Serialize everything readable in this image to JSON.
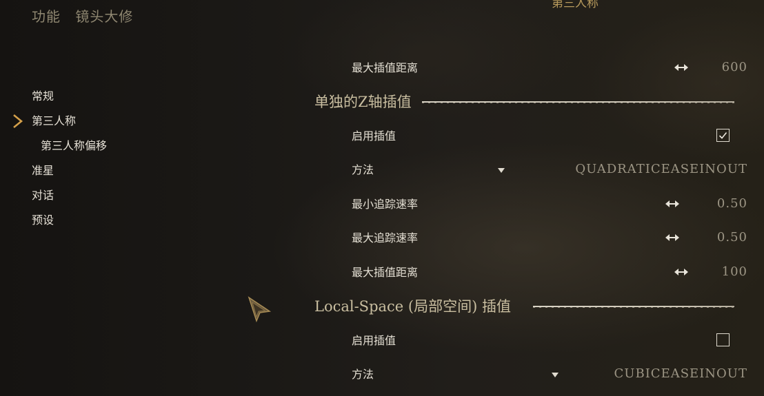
{
  "header": {
    "category": "功能",
    "mod_name": "镜头大修"
  },
  "top_title": "第三人称",
  "sidebar": {
    "items": [
      {
        "label": "常规",
        "active": false
      },
      {
        "label": "第三人称",
        "active": true
      },
      {
        "label": "第三人称偏移",
        "active": false
      },
      {
        "label": "准星",
        "active": false
      },
      {
        "label": "对话",
        "active": false
      },
      {
        "label": "预设",
        "active": false
      }
    ]
  },
  "settings": {
    "max_interp_distance_1": {
      "label": "最大插值距离",
      "value": "600"
    },
    "section_z": {
      "title": "单独的Z轴插值"
    },
    "z_enable": {
      "label": "启用插值",
      "checked": true
    },
    "z_method": {
      "label": "方法",
      "value": "QUADRATICEASEINOUT"
    },
    "z_min_speed": {
      "label": "最小追踪速率",
      "value": "0.50"
    },
    "z_max_speed": {
      "label": "最大追踪速率",
      "value": "0.50"
    },
    "z_max_distance": {
      "label": "最大插值距离",
      "value": "100"
    },
    "section_local": {
      "title": "Local-Space (局部空间) 插值"
    },
    "local_enable": {
      "label": "启用插值",
      "checked": false
    },
    "local_method": {
      "label": "方法",
      "value": "CUBICEASEINOUT"
    }
  },
  "icons": {
    "slider": "left-right-arrow-icon",
    "dropdown": "triangle-down-icon",
    "nav_selected": "chevron-right-icon",
    "cursor": "mouse-cursor-icon"
  },
  "colors": {
    "accent": "#d4a04a",
    "text": "#e4dfd3",
    "value": "#9c9584",
    "section": "#c9bea0"
  }
}
